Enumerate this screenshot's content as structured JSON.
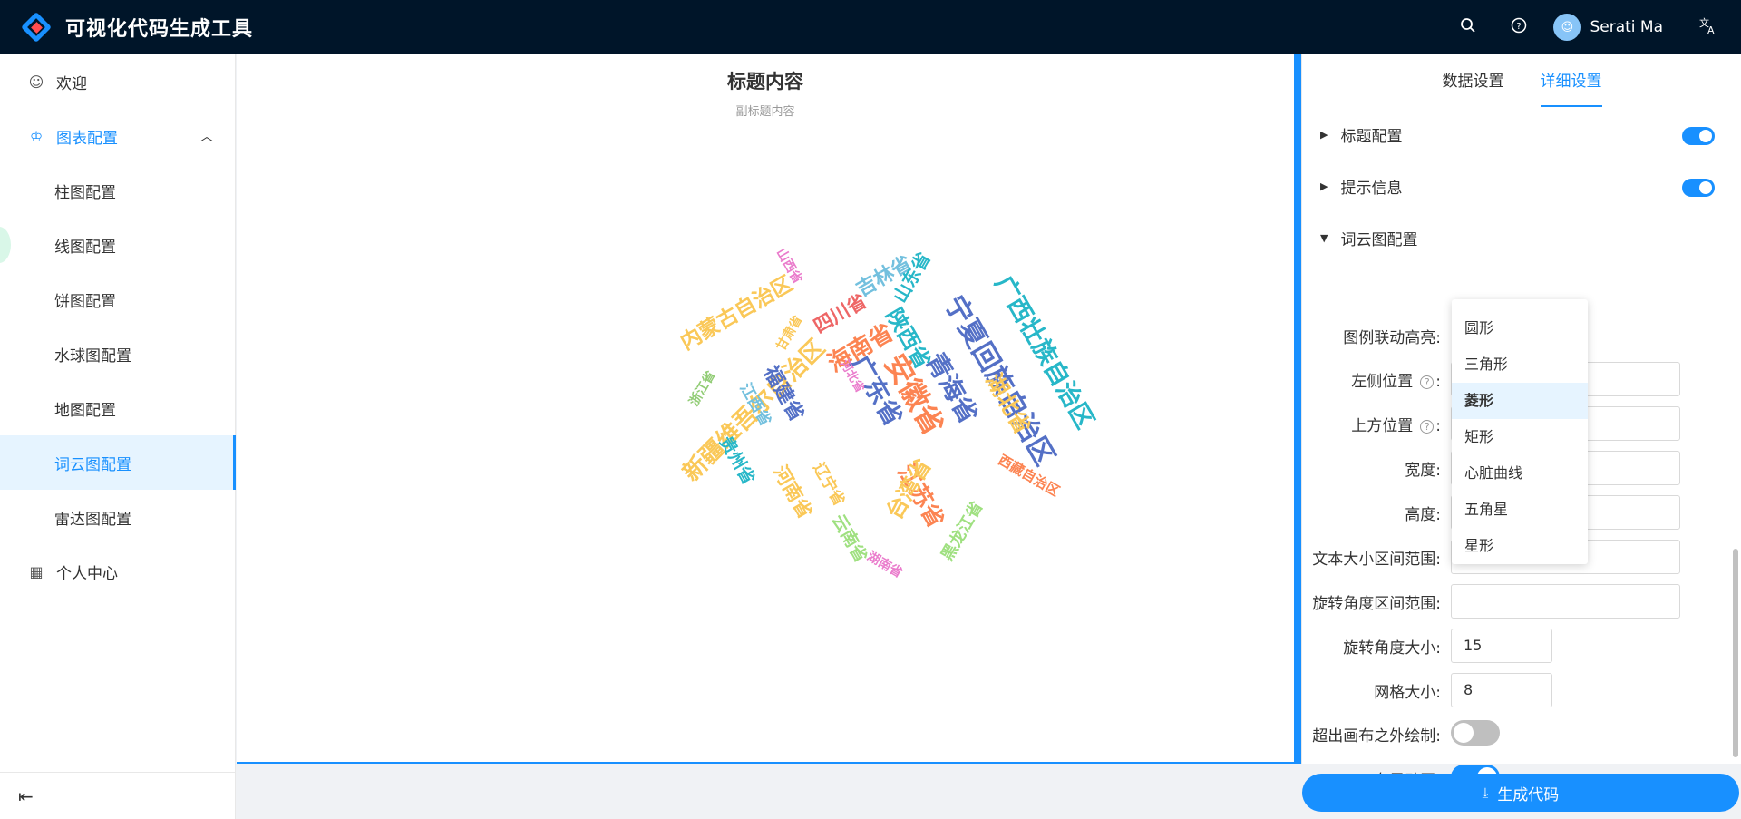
{
  "app": {
    "title": "可视化代码生成工具"
  },
  "header": {
    "search_icon": "search-icon",
    "help_icon": "help-icon",
    "user_name": "Serati Ma",
    "translate_icon": "translate-icon"
  },
  "sidebar": {
    "items": [
      {
        "label": "欢迎",
        "icon": "smile-icon"
      },
      {
        "label": "图表配置",
        "icon": "crown-icon"
      },
      {
        "label": "柱图配置"
      },
      {
        "label": "线图配置"
      },
      {
        "label": "饼图配置"
      },
      {
        "label": "水球图配置"
      },
      {
        "label": "地图配置"
      },
      {
        "label": "词云图配置"
      },
      {
        "label": "雷达图配置"
      },
      {
        "label": "个人中心",
        "icon": "table-icon"
      }
    ]
  },
  "chart": {
    "title": "标题内容",
    "subtitle": "副标题内容"
  },
  "wordcloud": {
    "words": [
      {
        "text": "内蒙古自治区",
        "color": "#fac858"
      },
      {
        "text": "新疆维吾尔自治区",
        "color": "#fac858"
      },
      {
        "text": "浙江省",
        "color": "#91cc75"
      },
      {
        "text": "福建省",
        "color": "#5470c6"
      },
      {
        "text": "江西省",
        "color": "#73c0de"
      },
      {
        "text": "贵州省",
        "color": "#27b7c8"
      },
      {
        "text": "甘肃省",
        "color": "#fac858"
      },
      {
        "text": "山西省",
        "color": "#ea7ccc"
      },
      {
        "text": "四川省",
        "color": "#ee6666"
      },
      {
        "text": "海南省",
        "color": "#fc8452"
      },
      {
        "text": "广东省",
        "color": "#5470c6"
      },
      {
        "text": "河北省",
        "color": "#ea7ccc"
      },
      {
        "text": "安徽省",
        "color": "#fc8452"
      },
      {
        "text": "吉林省",
        "color": "#73c0de"
      },
      {
        "text": "陕西省",
        "color": "#27b7c8"
      },
      {
        "text": "山东省",
        "color": "#27b7c8"
      },
      {
        "text": "青海省",
        "color": "#5470c6"
      },
      {
        "text": "宁夏回族自治区",
        "color": "#5470c6"
      },
      {
        "text": "广西壮族自治区",
        "color": "#27b7c8"
      },
      {
        "text": "湖北省",
        "color": "#fac858"
      },
      {
        "text": "西藏自治区",
        "color": "#fc8452"
      },
      {
        "text": "辽宁省",
        "color": "#fac858"
      },
      {
        "text": "河南省",
        "color": "#fac858"
      },
      {
        "text": "江苏省",
        "color": "#fc8452"
      },
      {
        "text": "台湾省",
        "color": "#fac858"
      },
      {
        "text": "云南省",
        "color": "#9fe080"
      },
      {
        "text": "湖南省",
        "color": "#ea7ccc"
      },
      {
        "text": "黑龙江省",
        "color": "#9fe080"
      }
    ]
  },
  "panel": {
    "tabs": [
      "数据设置",
      "详细设置"
    ],
    "sections": [
      {
        "label": "标题配置",
        "enabled": true
      },
      {
        "label": "提示信息",
        "enabled": true
      },
      {
        "label": "词云图配置"
      }
    ],
    "fields": {
      "legend_highlight": {
        "label": "图例联动高亮:",
        "value": "菱形"
      },
      "left": {
        "label": "左侧位置",
        "help": "?"
      },
      "top": {
        "label": "上方位置",
        "help": "?"
      },
      "width": {
        "label": "宽度:"
      },
      "height": {
        "label": "高度:"
      },
      "size_range": {
        "label": "文本大小区间范围:"
      },
      "rotation_range": {
        "label": "旋转角度区间范围:"
      },
      "rotation_step": {
        "label": "旋转角度大小:",
        "value": "15"
      },
      "grid_size": {
        "label": "网格大小:",
        "value": "8"
      },
      "draw_outside": {
        "label": "超出画布之外绘制:",
        "enabled": false
      },
      "layout_animation": {
        "label": "布局动画:",
        "enabled": true
      }
    },
    "shape_options": [
      "圆形",
      "三角形",
      "菱形",
      "矩形",
      "心脏曲线",
      "五角星",
      "星形"
    ],
    "selected_shape": "菱形",
    "colon": ":"
  },
  "footer": {
    "generate_label": "生成代码"
  },
  "colors": {
    "primary": "#1890ff",
    "header_bg": "#001529"
  }
}
